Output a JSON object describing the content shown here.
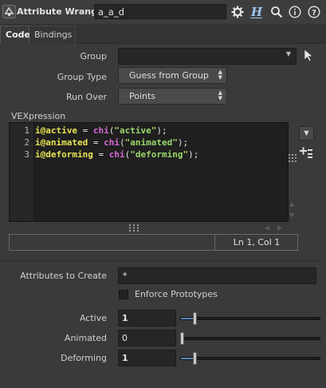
{
  "header": {
    "node_type": "Attribute Wrangle",
    "node_name": "a_a_d",
    "icons": [
      "node-type-icon",
      "gear-icon",
      "houdini-help-icon",
      "search-icon",
      "info-icon",
      "help-icon"
    ]
  },
  "tabs": [
    {
      "label": "Code",
      "active": true
    },
    {
      "label": "Bindings",
      "active": false
    }
  ],
  "params": {
    "group_label": "Group",
    "group_value": "",
    "group_type_label": "Group Type",
    "group_type_value": "Guess from Group",
    "run_over_label": "Run Over",
    "run_over_value": "Points",
    "vexpression_label": "VEXpression"
  },
  "code": {
    "line_numbers": [
      "1",
      "2",
      "3"
    ],
    "lines": [
      {
        "type": "i@",
        "var": "active",
        "op": " = ",
        "fn": "chi",
        "open": "(",
        "str": "\"active\"",
        "close": ");"
      },
      {
        "type": "i@",
        "var": "animated",
        "op": " = ",
        "fn": "chi",
        "open": "(",
        "str": "\"animated\"",
        "close": ");"
      },
      {
        "type": "i@",
        "var": "deforming",
        "op": " = ",
        "fn": "chi",
        "open": "(",
        "str": "\"deforming\"",
        "close": ");"
      }
    ],
    "cursor_status": "Ln 1, Col 1"
  },
  "attributes": {
    "create_label": "Attributes to Create",
    "create_value": "*",
    "enforce_label": "Enforce Prototypes",
    "enforce_checked": false
  },
  "sliders": [
    {
      "label": "Active",
      "value": "1",
      "fraction": 0.1,
      "bold": true
    },
    {
      "label": "Animated",
      "value": "0",
      "fraction": 0.0,
      "bold": false
    },
    {
      "label": "Deforming",
      "value": "1",
      "fraction": 0.1,
      "bold": true
    }
  ],
  "colors": {
    "background": "#3a3a3a",
    "field": "#262626",
    "editor": "#1f1f1f",
    "keyword": "#e8e455",
    "function": "#d96ad9",
    "string": "#9ad86a",
    "slider_fill": "#5a86c0"
  }
}
